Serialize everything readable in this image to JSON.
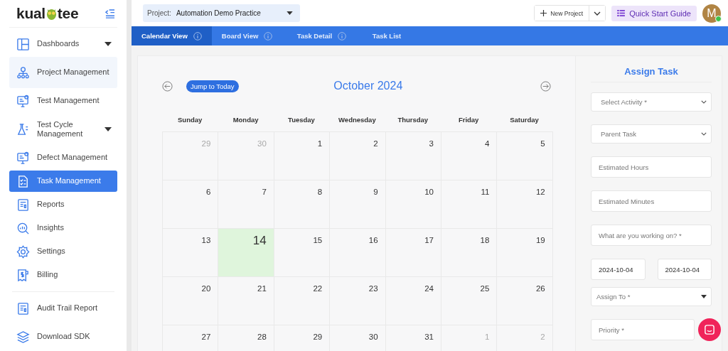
{
  "sidebar": {
    "logo": {
      "left": "kual",
      "right": "tee"
    },
    "nav_groups": [
      [
        {
          "label": "Dashboards",
          "selected": false,
          "hovered": false,
          "has_caret": true
        },
        {
          "label": "Project Management",
          "selected": false,
          "hovered": true,
          "has_caret": false
        },
        {
          "label": "Test Management",
          "selected": false,
          "hovered": false,
          "has_caret": false
        },
        {
          "label": "Test Cycle Management",
          "selected": false,
          "hovered": false,
          "has_caret": true
        },
        {
          "label": "Defect Management",
          "selected": false,
          "hovered": false,
          "has_caret": false
        },
        {
          "label": "Task Management",
          "selected": true,
          "hovered": false,
          "has_caret": false
        },
        {
          "label": "Reports",
          "selected": false,
          "hovered": false,
          "has_caret": false
        },
        {
          "label": "Insights",
          "selected": false,
          "hovered": false,
          "has_caret": false
        },
        {
          "label": "Settings",
          "selected": false,
          "hovered": false,
          "has_caret": false
        },
        {
          "label": "Billing",
          "selected": false,
          "hovered": false,
          "has_caret": false
        }
      ],
      [
        {
          "label": "Audit Trail Report",
          "selected": false,
          "hovered": false,
          "has_caret": false
        },
        {
          "label": "Download SDK",
          "selected": false,
          "hovered": false,
          "has_caret": false
        }
      ]
    ]
  },
  "header": {
    "project_label": "Project:",
    "project_value": "Automation Demo Practice",
    "new_project": "New Project",
    "quick_start": "Quick Start Guide",
    "avatar_initial": "M",
    "online": true
  },
  "tabs": [
    {
      "label": "Calendar View",
      "selected": true,
      "info": true
    },
    {
      "label": "Board View",
      "selected": false,
      "info": true
    },
    {
      "label": "Task Detail",
      "selected": false,
      "info": true
    },
    {
      "label": "Task List",
      "selected": false,
      "info": false
    }
  ],
  "calendar": {
    "jump_button": "Jump to Today",
    "month_title": "October 2024",
    "weekdays": [
      "Sunday",
      "Monday",
      "Tuesday",
      "Wednesday",
      "Thursday",
      "Friday",
      "Saturday"
    ],
    "weeks": [
      [
        {
          "day": "29",
          "other_month": true,
          "today": false
        },
        {
          "day": "30",
          "other_month": true,
          "today": false
        },
        {
          "day": "1",
          "other_month": false,
          "today": false
        },
        {
          "day": "2",
          "other_month": false,
          "today": false
        },
        {
          "day": "3",
          "other_month": false,
          "today": false
        },
        {
          "day": "4",
          "other_month": false,
          "today": false
        },
        {
          "day": "5",
          "other_month": false,
          "today": false
        }
      ],
      [
        {
          "day": "6",
          "other_month": false,
          "today": false
        },
        {
          "day": "7",
          "other_month": false,
          "today": false
        },
        {
          "day": "8",
          "other_month": false,
          "today": false
        },
        {
          "day": "9",
          "other_month": false,
          "today": false
        },
        {
          "day": "10",
          "other_month": false,
          "today": false
        },
        {
          "day": "11",
          "other_month": false,
          "today": false
        },
        {
          "day": "12",
          "other_month": false,
          "today": false
        }
      ],
      [
        {
          "day": "13",
          "other_month": false,
          "today": false
        },
        {
          "day": "14",
          "other_month": false,
          "today": true
        },
        {
          "day": "15",
          "other_month": false,
          "today": false
        },
        {
          "day": "16",
          "other_month": false,
          "today": false
        },
        {
          "day": "17",
          "other_month": false,
          "today": false
        },
        {
          "day": "18",
          "other_month": false,
          "today": false
        },
        {
          "day": "19",
          "other_month": false,
          "today": false
        }
      ],
      [
        {
          "day": "20",
          "other_month": false,
          "today": false
        },
        {
          "day": "21",
          "other_month": false,
          "today": false
        },
        {
          "day": "22",
          "other_month": false,
          "today": false
        },
        {
          "day": "23",
          "other_month": false,
          "today": false
        },
        {
          "day": "24",
          "other_month": false,
          "today": false
        },
        {
          "day": "25",
          "other_month": false,
          "today": false
        },
        {
          "day": "26",
          "other_month": false,
          "today": false
        }
      ],
      [
        {
          "day": "27",
          "other_month": false,
          "today": false
        },
        {
          "day": "28",
          "other_month": false,
          "today": false
        },
        {
          "day": "29",
          "other_month": false,
          "today": false
        },
        {
          "day": "30",
          "other_month": false,
          "today": false
        },
        {
          "day": "31",
          "other_month": false,
          "today": false
        },
        {
          "day": "1",
          "other_month": true,
          "today": false
        },
        {
          "day": "2",
          "other_month": true,
          "today": false
        }
      ]
    ]
  },
  "assign_task": {
    "title": "Assign Task",
    "fields": [
      {
        "kind": "select",
        "placeholder": "Select Activity *"
      },
      {
        "kind": "select",
        "placeholder": "Parent Task"
      },
      {
        "kind": "input",
        "placeholder": "Estimated Hours"
      },
      {
        "kind": "input",
        "placeholder": "Estimated Minutes"
      },
      {
        "kind": "input",
        "placeholder": "What are you working on? *"
      },
      {
        "kind": "dates",
        "values": [
          "2024-10-04",
          "2024-10-04"
        ]
      },
      {
        "kind": "dropdown",
        "placeholder": "Assign To *"
      },
      {
        "kind": "input",
        "placeholder": "Priority *"
      }
    ]
  }
}
